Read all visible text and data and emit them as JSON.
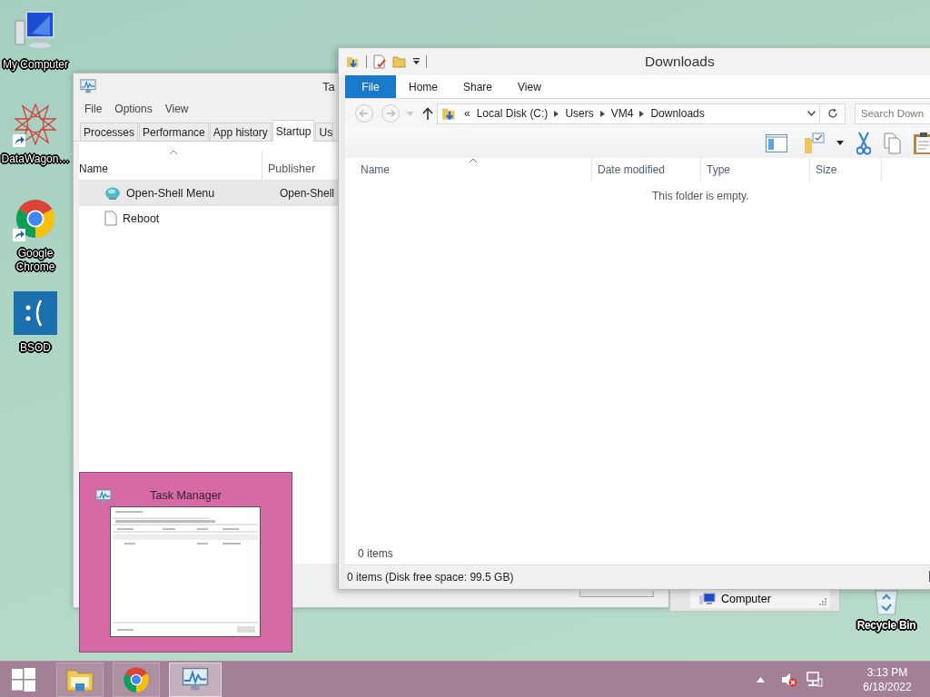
{
  "desktop_icons": [
    {
      "label": "My Computer",
      "kind": "computer"
    },
    {
      "label": "DataWagon…",
      "kind": "star"
    },
    {
      "label": "Google Chrome",
      "kind": "chrome"
    },
    {
      "label": "BSOD",
      "kind": "sad"
    }
  ],
  "task_manager": {
    "title": "Ta",
    "menu": [
      "File",
      "Options",
      "View"
    ],
    "tabs": [
      {
        "label": "Processes",
        "selected": false
      },
      {
        "label": "Performance",
        "selected": false
      },
      {
        "label": "App history",
        "selected": false
      },
      {
        "label": "Startup",
        "selected": true
      },
      {
        "label": "Us",
        "selected": false
      }
    ],
    "columns": [
      "Name",
      "Publisher"
    ],
    "rows": [
      {
        "name": "Open-Shell Menu",
        "publisher": "Open-Shell",
        "kind": "app",
        "selected": true
      },
      {
        "name": "Reboot",
        "kind": "file",
        "selected": false
      }
    ]
  },
  "computer_window": {
    "label": "Computer"
  },
  "recycle_bin": {
    "label": "Recycle Bin"
  },
  "explorer": {
    "title": "Downloads",
    "ribbon_tabs": [
      {
        "label": "File",
        "kind": "menu"
      },
      {
        "label": "Home",
        "kind": "tab"
      },
      {
        "label": "Share",
        "kind": "tab"
      },
      {
        "label": "View",
        "kind": "tab"
      }
    ],
    "address": {
      "overflow_mark": "«",
      "crumbs": [
        "Local Disk (C:)",
        "Users",
        "VM4",
        "Downloads"
      ]
    },
    "search": {
      "placeholder": "Search Down"
    },
    "columns": [
      "Name",
      "Date modified",
      "Type",
      "Size"
    ],
    "empty_message": "This folder is empty.",
    "item_count": "0 items",
    "status": "0 items (Disk free space: 99.5 GB)"
  },
  "thumbnail": {
    "title": "Task Manager"
  },
  "taskbar": {
    "apps": [
      {
        "kind": "explorer",
        "selected": false
      },
      {
        "kind": "chrome",
        "selected": false
      },
      {
        "kind": "taskmgr",
        "selected": true
      }
    ],
    "time": "3:13 PM",
    "date": "6/18/2022"
  }
}
